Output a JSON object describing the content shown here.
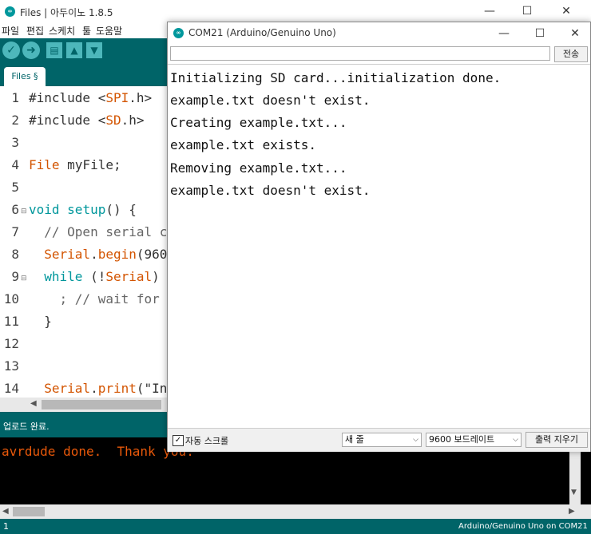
{
  "ide": {
    "window_title": "Files | 아두이노 1.8.5",
    "menu": [
      "파일",
      "편집",
      "스케치",
      "툴",
      "도움말"
    ],
    "tab_label": "Files §",
    "line_numbers": [
      "1",
      "2",
      "3",
      "4",
      "5",
      "6",
      "7",
      "8",
      "9",
      "10",
      "11",
      "12",
      "13",
      "14"
    ],
    "code": {
      "l1a": "#include <",
      "l1b": "SPI",
      "l1c": ".h>",
      "l2a": "#include <",
      "l2b": "SD",
      "l2c": ".h>",
      "l4a": "File",
      "l4b": " myFile;",
      "l6a": "void",
      "l6b": " ",
      "l6c": "setup",
      "l6d": "() {",
      "l7": "  // Open serial c",
      "l8a": "  ",
      "l8b": "Serial",
      "l8c": ".",
      "l8d": "begin",
      "l8e": "(960",
      "l9a": "  ",
      "l9b": "while",
      "l9c": " (!",
      "l9d": "Serial",
      "l9e": ")",
      "l10": "    ; // wait for",
      "l11": "  }",
      "l14a": "  ",
      "l14b": "Serial",
      "l14c": ".",
      "l14d": "print",
      "l14e": "(\"In"
    },
    "status_message": "업로드 완료.",
    "console_text": "avrdude done.  Thank you.",
    "footer_line": "1",
    "footer_board": "Arduino/Genuino Uno on COM21"
  },
  "serial": {
    "title": "COM21 (Arduino/Genuino Uno)",
    "send_label": "전송",
    "input_value": "",
    "lines": [
      "Initializing SD card...initialization done.",
      "example.txt doesn't exist.",
      "Creating example.txt...",
      "example.txt exists.",
      "Removing example.txt...",
      "example.txt doesn't exist."
    ],
    "autoscroll_label": "자동 스크롤",
    "autoscroll_checked": true,
    "line_ending": "새 줄",
    "baud_rate": "9600 보드레이트",
    "clear_label": "출력 지우기"
  },
  "colors": {
    "teal_dark": "#006468",
    "teal_light": "#4db7bb",
    "keyword_orange": "#d35400",
    "function_teal": "#00979c",
    "console_orange": "#e8580a"
  }
}
